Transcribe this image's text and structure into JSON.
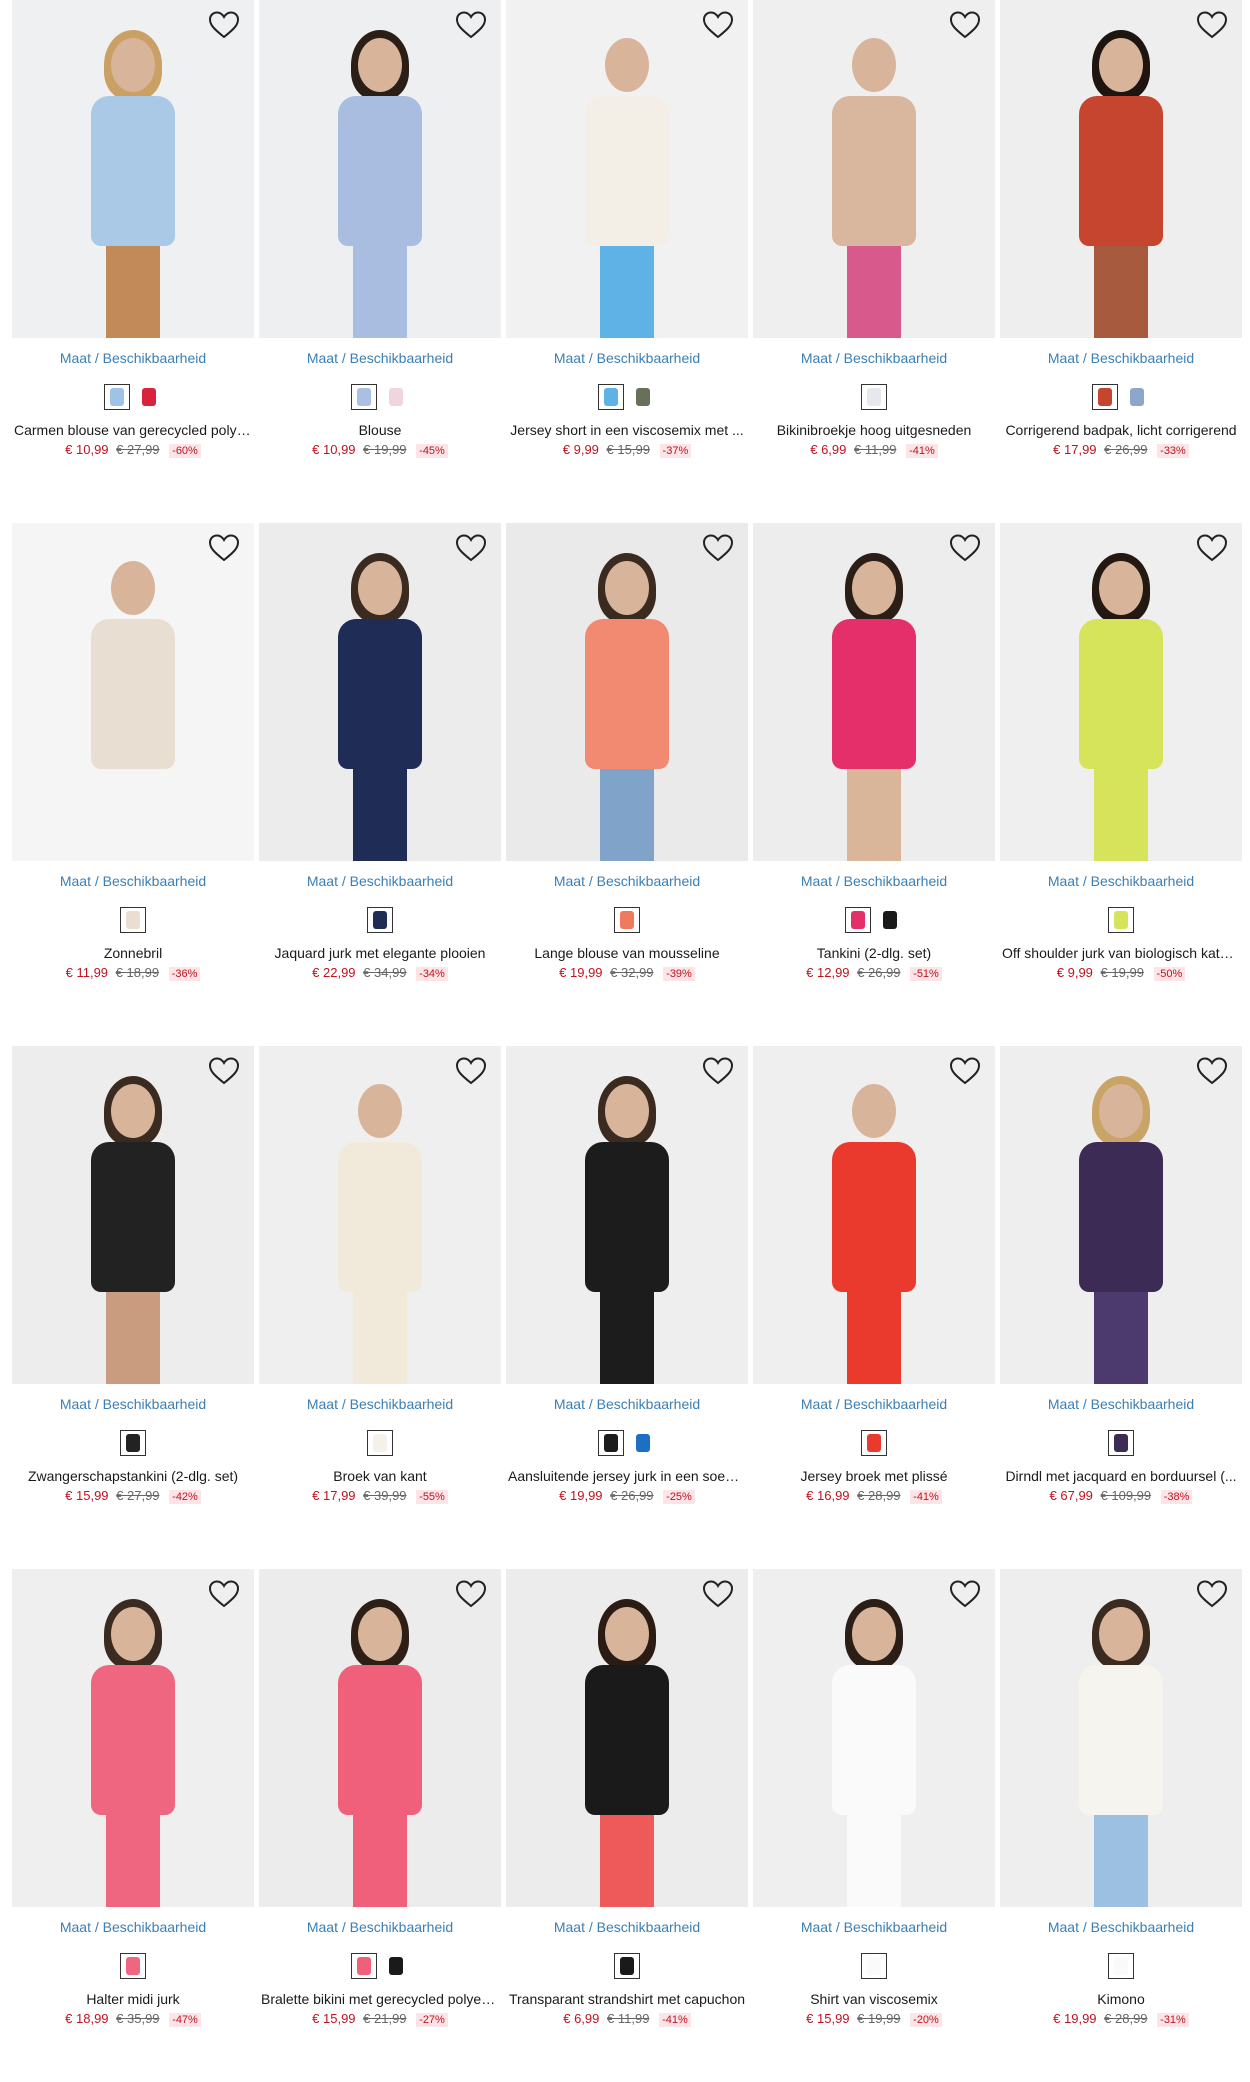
{
  "products": [
    {
      "name": "Carmen blouse van gerecycled polyester",
      "price": "€ 10,99",
      "old_price": "€ 27,99",
      "discount": "-60%",
      "maat": "Maat / Beschikbaarheid",
      "bg": "#eef0f2",
      "top": "#a9c9e6",
      "bottom": "#c28a58",
      "hair": "#caa065",
      "swatches": [
        "#9ec3e6",
        "#d9223b"
      ]
    },
    {
      "name": "Blouse",
      "price": "€ 10,99",
      "old_price": "€ 19,99",
      "discount": "-45%",
      "maat": "Maat / Beschikbaarheid",
      "bg": "#eeeff1",
      "top": "#a8bde0",
      "bottom": "#a8bde0",
      "hair": "#2a1e17",
      "swatches": [
        "#a9c0e4",
        "#f0d6dc"
      ]
    },
    {
      "name": "Jersey short in een viscosemix met ...",
      "price": "€ 9,99",
      "old_price": "€ 15,99",
      "discount": "-37%",
      "maat": "Maat / Beschikbaarheid",
      "bg": "#f1f1f1",
      "top": "#f3efe6",
      "bottom": "#5eb2e6",
      "hair": "#f1f1f1",
      "swatches": [
        "#5eb2e6",
        "#66705a"
      ]
    },
    {
      "name": "Bikinibroekje hoog uitgesneden",
      "price": "€ 6,99",
      "old_price": "€ 11,99",
      "discount": "-41%",
      "maat": "Maat / Beschikbaarheid",
      "bg": "#efefef",
      "top": "#d9b79e",
      "bottom": "#d85a8c",
      "hair": "#efefef",
      "swatches": [
        "#e7e7ef"
      ]
    },
    {
      "name": "Corrigerend badpak, licht corrigerend",
      "price": "€ 17,99",
      "old_price": "€ 26,99",
      "discount": "-33%",
      "maat": "Maat / Beschikbaarheid",
      "bg": "#eeeeee",
      "top": "#c6452e",
      "bottom": "#a85a3e",
      "hair": "#1e1510",
      "swatches": [
        "#c6452e",
        "#8ea6c9"
      ]
    },
    {
      "name": "Zonnebril",
      "price": "€ 11,99",
      "old_price": "€ 18,99",
      "discount": "-36%",
      "maat": "Maat / Beschikbaarheid",
      "bg": "#f5f5f5",
      "top": "#e9ded2",
      "bottom": "#f5f5f5",
      "hair": "#f5f5f5",
      "swatches": [
        "#e9ded2"
      ]
    },
    {
      "name": "Jaquard jurk met elegante plooien",
      "price": "€ 22,99",
      "old_price": "€ 34,99",
      "discount": "-34%",
      "maat": "Maat / Beschikbaarheid",
      "bg": "#ececec",
      "top": "#1f2c56",
      "bottom": "#1f2c56",
      "hair": "#3a2a20",
      "swatches": [
        "#1f2c56"
      ]
    },
    {
      "name": "Lange blouse van mousseline",
      "price": "€ 19,99",
      "old_price": "€ 32,99",
      "discount": "-39%",
      "maat": "Maat / Beschikbaarheid",
      "bg": "#eaeaea",
      "top": "#f28a72",
      "bottom": "#7fa3c9",
      "hair": "#3a2a20",
      "swatches": [
        "#f07a5e"
      ]
    },
    {
      "name": "Tankini (2-dlg. set)",
      "price": "€ 12,99",
      "old_price": "€ 26,99",
      "discount": "-51%",
      "maat": "Maat / Beschikbaarheid",
      "bg": "#ededed",
      "top": "#e52f6a",
      "bottom": "#d9b59a",
      "hair": "#2a1e17",
      "swatches": [
        "#e52f6a",
        "#1a1a1a"
      ]
    },
    {
      "name": "Off shoulder jurk van biologisch katoen",
      "price": "€ 9,99",
      "old_price": "€ 19,99",
      "discount": "-50%",
      "maat": "Maat / Beschikbaarheid",
      "bg": "#efefef",
      "top": "#d5e45b",
      "bottom": "#d5e45b",
      "hair": "#241812",
      "swatches": [
        "#d5e45b"
      ]
    },
    {
      "name": "Zwangerschapstankini (2-dlg. set)",
      "price": "€ 15,99",
      "old_price": "€ 27,99",
      "discount": "-42%",
      "maat": "Maat / Beschikbaarheid",
      "bg": "#ededed",
      "top": "#222222",
      "bottom": "#c99c80",
      "hair": "#3a2a20",
      "swatches": [
        "#222222"
      ]
    },
    {
      "name": "Broek van kant",
      "price": "€ 17,99",
      "old_price": "€ 39,99",
      "discount": "-55%",
      "maat": "Maat / Beschikbaarheid",
      "bg": "#efefef",
      "top": "#f1eadb",
      "bottom": "#f1eadb",
      "hair": "#efefef",
      "swatches": [
        "#f5f1e8"
      ]
    },
    {
      "name": "Aansluitende jersey jurk in een soepele ...",
      "price": "€ 19,99",
      "old_price": "€ 26,99",
      "discount": "-25%",
      "maat": "Maat / Beschikbaarheid",
      "bg": "#eeeeee",
      "top": "#1c1c1c",
      "bottom": "#1c1c1c",
      "hair": "#3a2a20",
      "swatches": [
        "#1c1c1c",
        "#1d6fc4"
      ]
    },
    {
      "name": "Jersey broek met plissé",
      "price": "€ 16,99",
      "old_price": "€ 28,99",
      "discount": "-41%",
      "maat": "Maat / Beschikbaarheid",
      "bg": "#efefef",
      "top": "#ea3a2e",
      "bottom": "#ea3a2e",
      "hair": "#efefef",
      "swatches": [
        "#ea3a2e"
      ]
    },
    {
      "name": "Dirndl met jacquard en borduursel (...",
      "price": "€ 67,99",
      "old_price": "€ 109,99",
      "discount": "-38%",
      "maat": "Maat / Beschikbaarheid",
      "bg": "#eeeeee",
      "top": "#3b2b55",
      "bottom": "#4c3a6e",
      "hair": "#c9a466",
      "swatches": [
        "#3b2b55"
      ]
    },
    {
      "name": "Halter midi jurk",
      "price": "€ 18,99",
      "old_price": "€ 35,99",
      "discount": "-47%",
      "maat": "Maat / Beschikbaarheid",
      "bg": "#efefef",
      "top": "#ee6680",
      "bottom": "#ee6680",
      "hair": "#3a2a20",
      "swatches": [
        "#ee6680"
      ]
    },
    {
      "name": "Bralette bikini met gerecycled polyester",
      "price": "€ 15,99",
      "old_price": "€ 21,99",
      "discount": "-27%",
      "maat": "Maat / Beschikbaarheid",
      "bg": "#ececec",
      "top": "#f0607a",
      "bottom": "#f0607a",
      "hair": "#2e1f16",
      "swatches": [
        "#f0607a",
        "#1a1a1a"
      ]
    },
    {
      "name": "Transparant strandshirt met capuchon",
      "price": "€ 6,99",
      "old_price": "€ 11,99",
      "discount": "-41%",
      "maat": "Maat / Beschikbaarheid",
      "bg": "#ececec",
      "top": "#1a1a1a",
      "bottom": "#ee5a5a",
      "hair": "#2a1c14",
      "swatches": [
        "#1a1a1a"
      ]
    },
    {
      "name": "Shirt van viscosemix",
      "price": "€ 15,99",
      "old_price": "€ 19,99",
      "discount": "-20%",
      "maat": "Maat / Beschikbaarheid",
      "bg": "#efefef",
      "top": "#fafafa",
      "bottom": "#fafafa",
      "hair": "#2a1e17",
      "swatches": [
        "#fafafa"
      ]
    },
    {
      "name": "Kimono",
      "price": "€ 19,99",
      "old_price": "€ 28,99",
      "discount": "-31%",
      "maat": "Maat / Beschikbaarheid",
      "bg": "#eeeeee",
      "top": "#f6f4ee",
      "bottom": "#9cc0e2",
      "hair": "#3a2a20",
      "swatches": [
        "#fafafa"
      ]
    }
  ],
  "icons": {
    "favorite": "heart-outline-icon"
  }
}
